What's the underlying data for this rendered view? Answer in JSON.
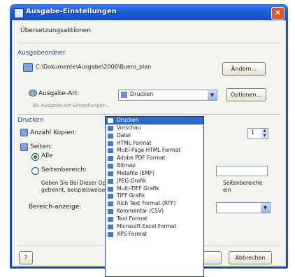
{
  "window": {
    "title": "Ausgabe-Einstellungen",
    "close_label": "✕"
  },
  "section_top": {
    "label": "Übersetzungsaktionen"
  },
  "output_group": {
    "header": "Ausgabeordner",
    "path": "C:\\Dokumente\\Ausgabe\\2006\\Buero_plan",
    "browse_button": "Ändern..."
  },
  "output_format": {
    "label": "Ausgabe-Art:",
    "selected": "Drucken",
    "options_button": "Optionen...",
    "hint": "Bu Ausgabe-Art Einstellungen..."
  },
  "pages_group": {
    "header": "Drucken",
    "copies_label": "Anzahl Kopien:",
    "copies_value": "1",
    "pages_label": "Seiten:",
    "radio_all": "Alle",
    "radio_range": "Seitenbereich:",
    "note": "Geben Sie Bei Dieser Option Seitenzahl und Seitenbereiche",
    "note2": "getrennt, beispielsweise 1;3;5-12",
    "note_right": "Seitenbereiche",
    "note_right2": "ein",
    "range_label": "Bereich-anzeige:"
  },
  "footer": {
    "help_icon": "help-icon",
    "ok_button": "OK",
    "cancel_button": "Abbrechen"
  },
  "dropdown": {
    "items": [
      "Drucken",
      "Vorschau",
      "Datei",
      "HTML Format",
      "Multi-Page HTML Format",
      "Adobe PDF Format",
      "Bitmap",
      "Metafile (EMF)",
      "JPEG Grafik",
      "Multi-TIFF Grafik",
      "TIFF Grafik",
      "Rich Text Format (RTF)",
      "Kommentar (CSV)",
      "Text Format",
      "Microsoft Excel Format",
      "XPS Format"
    ],
    "selected_index": 0
  }
}
